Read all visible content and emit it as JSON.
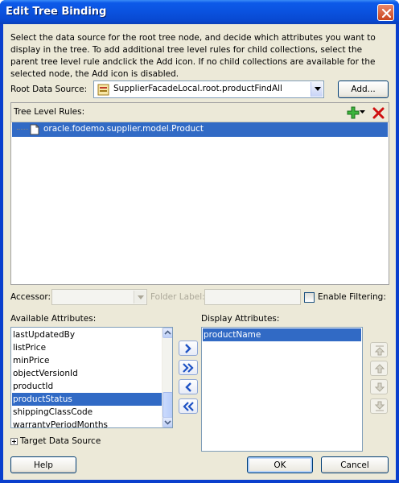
{
  "window": {
    "title": "Edit Tree Binding"
  },
  "description": "Select the data source for the root tree node, and decide which attributes you want to display in the tree. To add additional tree level rules for child collections, select the parent tree level rule andclick the Add icon. If no child collections are available for the selected node, the Add icon is disabled.",
  "root_data_source": {
    "label": "Root Data Source:",
    "value": "SupplierFacadeLocal.root.productFindAll",
    "add_label": "Add..."
  },
  "tree_level_rules": {
    "label": "Tree Level Rules:",
    "rows": [
      "oracle.fodemo.supplier.model.Product"
    ]
  },
  "accessor": {
    "label": "Accessor:",
    "value": ""
  },
  "folder_label": {
    "label": "Folder Label:",
    "value": ""
  },
  "enable_filtering": {
    "label": "Enable Filtering:",
    "checked": false
  },
  "available_attributes": {
    "label": "Available Attributes:",
    "items": [
      "lastUpdatedBy",
      "listPrice",
      "minPrice",
      "objectVersionId",
      "productId",
      "productStatus",
      "shippingClassCode",
      "warrantyPeriodMonths"
    ],
    "selected": "productStatus"
  },
  "display_attributes": {
    "label": "Display Attributes:",
    "items": [
      "productName"
    ],
    "selected": "productName"
  },
  "target_data_source": {
    "label": "Target Data Source"
  },
  "buttons": {
    "help": "Help",
    "ok": "OK",
    "cancel": "Cancel"
  },
  "colors": {
    "selection": "#316ac5",
    "title_bar": "#0a52df",
    "dialog_bg": "#ece9d8"
  }
}
